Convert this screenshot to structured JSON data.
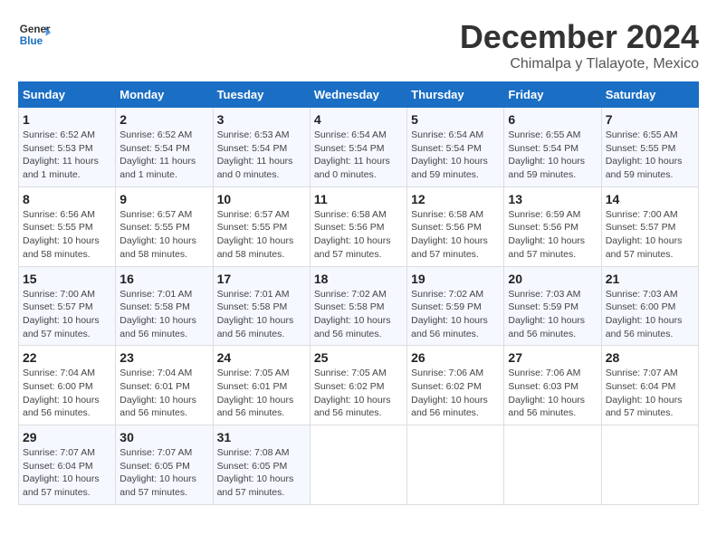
{
  "logo": {
    "line1": "General",
    "line2": "Blue"
  },
  "title": "December 2024",
  "subtitle": "Chimalpa y Tlalayote, Mexico",
  "weekdays": [
    "Sunday",
    "Monday",
    "Tuesday",
    "Wednesday",
    "Thursday",
    "Friday",
    "Saturday"
  ],
  "weeks": [
    [
      {
        "day": "1",
        "sunrise": "6:52 AM",
        "sunset": "5:53 PM",
        "daylight": "11 hours and 1 minute."
      },
      {
        "day": "2",
        "sunrise": "6:52 AM",
        "sunset": "5:54 PM",
        "daylight": "11 hours and 1 minute."
      },
      {
        "day": "3",
        "sunrise": "6:53 AM",
        "sunset": "5:54 PM",
        "daylight": "11 hours and 0 minutes."
      },
      {
        "day": "4",
        "sunrise": "6:54 AM",
        "sunset": "5:54 PM",
        "daylight": "11 hours and 0 minutes."
      },
      {
        "day": "5",
        "sunrise": "6:54 AM",
        "sunset": "5:54 PM",
        "daylight": "10 hours and 59 minutes."
      },
      {
        "day": "6",
        "sunrise": "6:55 AM",
        "sunset": "5:54 PM",
        "daylight": "10 hours and 59 minutes."
      },
      {
        "day": "7",
        "sunrise": "6:55 AM",
        "sunset": "5:55 PM",
        "daylight": "10 hours and 59 minutes."
      }
    ],
    [
      {
        "day": "8",
        "sunrise": "6:56 AM",
        "sunset": "5:55 PM",
        "daylight": "10 hours and 58 minutes."
      },
      {
        "day": "9",
        "sunrise": "6:57 AM",
        "sunset": "5:55 PM",
        "daylight": "10 hours and 58 minutes."
      },
      {
        "day": "10",
        "sunrise": "6:57 AM",
        "sunset": "5:55 PM",
        "daylight": "10 hours and 58 minutes."
      },
      {
        "day": "11",
        "sunrise": "6:58 AM",
        "sunset": "5:56 PM",
        "daylight": "10 hours and 57 minutes."
      },
      {
        "day": "12",
        "sunrise": "6:58 AM",
        "sunset": "5:56 PM",
        "daylight": "10 hours and 57 minutes."
      },
      {
        "day": "13",
        "sunrise": "6:59 AM",
        "sunset": "5:56 PM",
        "daylight": "10 hours and 57 minutes."
      },
      {
        "day": "14",
        "sunrise": "7:00 AM",
        "sunset": "5:57 PM",
        "daylight": "10 hours and 57 minutes."
      }
    ],
    [
      {
        "day": "15",
        "sunrise": "7:00 AM",
        "sunset": "5:57 PM",
        "daylight": "10 hours and 57 minutes."
      },
      {
        "day": "16",
        "sunrise": "7:01 AM",
        "sunset": "5:58 PM",
        "daylight": "10 hours and 56 minutes."
      },
      {
        "day": "17",
        "sunrise": "7:01 AM",
        "sunset": "5:58 PM",
        "daylight": "10 hours and 56 minutes."
      },
      {
        "day": "18",
        "sunrise": "7:02 AM",
        "sunset": "5:58 PM",
        "daylight": "10 hours and 56 minutes."
      },
      {
        "day": "19",
        "sunrise": "7:02 AM",
        "sunset": "5:59 PM",
        "daylight": "10 hours and 56 minutes."
      },
      {
        "day": "20",
        "sunrise": "7:03 AM",
        "sunset": "5:59 PM",
        "daylight": "10 hours and 56 minutes."
      },
      {
        "day": "21",
        "sunrise": "7:03 AM",
        "sunset": "6:00 PM",
        "daylight": "10 hours and 56 minutes."
      }
    ],
    [
      {
        "day": "22",
        "sunrise": "7:04 AM",
        "sunset": "6:00 PM",
        "daylight": "10 hours and 56 minutes."
      },
      {
        "day": "23",
        "sunrise": "7:04 AM",
        "sunset": "6:01 PM",
        "daylight": "10 hours and 56 minutes."
      },
      {
        "day": "24",
        "sunrise": "7:05 AM",
        "sunset": "6:01 PM",
        "daylight": "10 hours and 56 minutes."
      },
      {
        "day": "25",
        "sunrise": "7:05 AM",
        "sunset": "6:02 PM",
        "daylight": "10 hours and 56 minutes."
      },
      {
        "day": "26",
        "sunrise": "7:06 AM",
        "sunset": "6:02 PM",
        "daylight": "10 hours and 56 minutes."
      },
      {
        "day": "27",
        "sunrise": "7:06 AM",
        "sunset": "6:03 PM",
        "daylight": "10 hours and 56 minutes."
      },
      {
        "day": "28",
        "sunrise": "7:07 AM",
        "sunset": "6:04 PM",
        "daylight": "10 hours and 57 minutes."
      }
    ],
    [
      {
        "day": "29",
        "sunrise": "7:07 AM",
        "sunset": "6:04 PM",
        "daylight": "10 hours and 57 minutes."
      },
      {
        "day": "30",
        "sunrise": "7:07 AM",
        "sunset": "6:05 PM",
        "daylight": "10 hours and 57 minutes."
      },
      {
        "day": "31",
        "sunrise": "7:08 AM",
        "sunset": "6:05 PM",
        "daylight": "10 hours and 57 minutes."
      },
      null,
      null,
      null,
      null
    ]
  ],
  "labels": {
    "sunrise_prefix": "Sunrise: ",
    "sunset_prefix": "Sunset: ",
    "daylight_prefix": "Daylight: "
  }
}
